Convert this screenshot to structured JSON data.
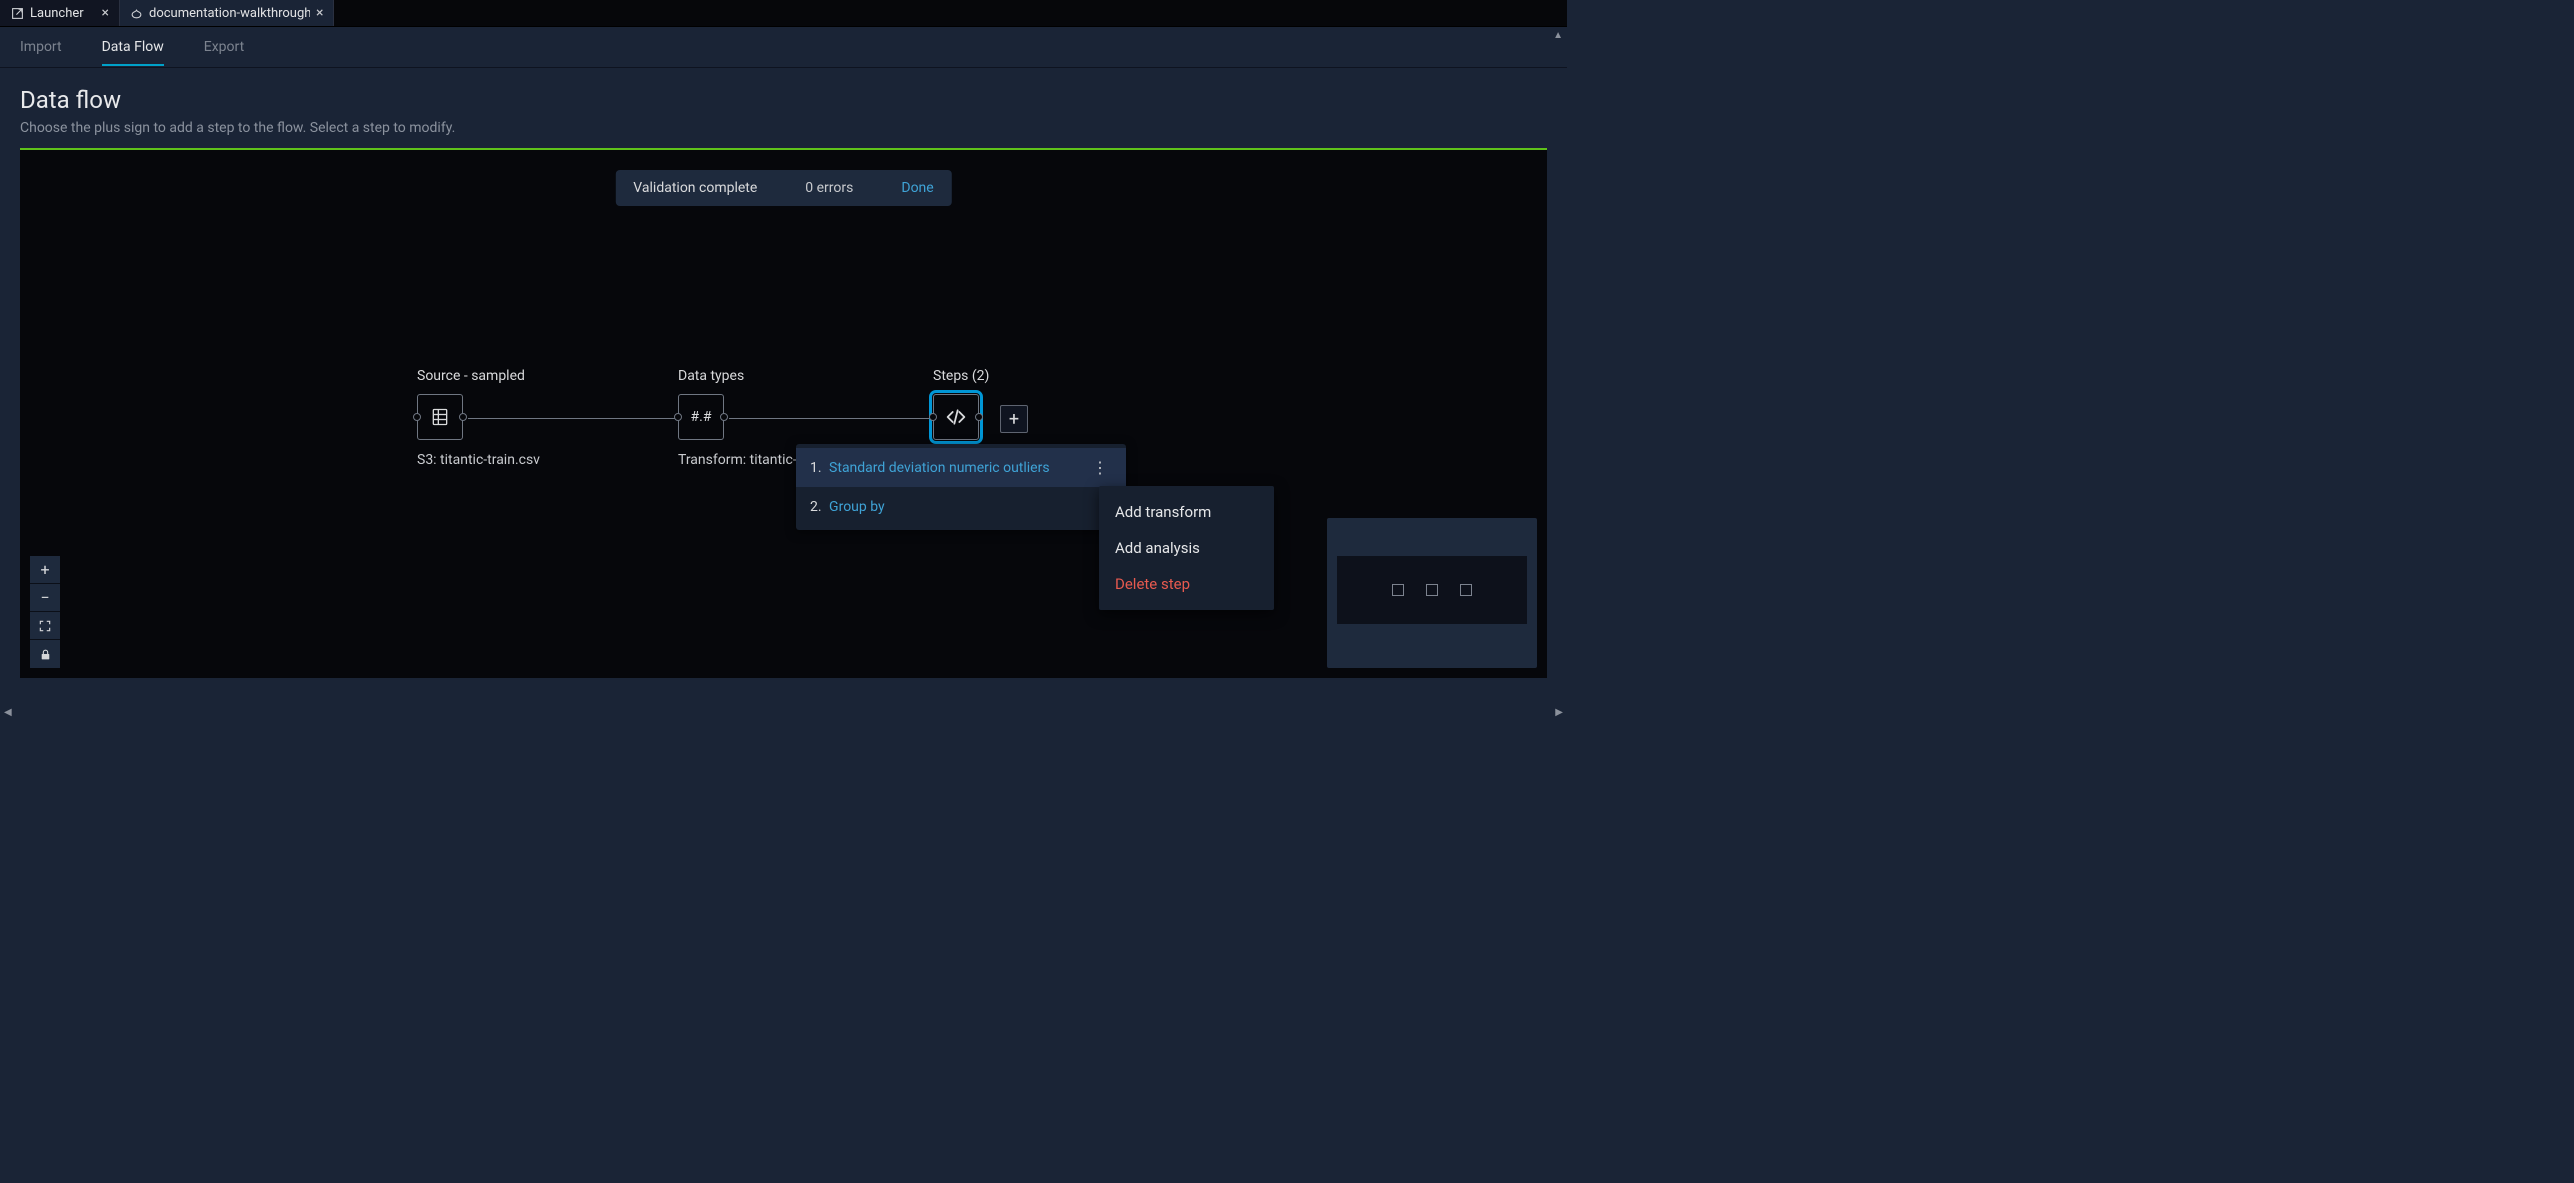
{
  "tabs": {
    "launcher": "Launcher",
    "doc": "documentation-walkthrough-"
  },
  "subnav": {
    "import": "Import",
    "data_flow": "Data Flow",
    "export": "Export"
  },
  "header": {
    "title": "Data flow",
    "hint": "Choose the plus sign to add a step to the flow. Select a step to modify."
  },
  "validation": {
    "status": "Validation complete",
    "errors": "0 errors",
    "done": "Done"
  },
  "nodes": {
    "source": {
      "title": "Source - sampled",
      "sub": "S3: titantic-train.csv"
    },
    "types": {
      "title": "Data types",
      "sub": "Transform: titantic-t",
      "glyph": "#.#"
    },
    "steps": {
      "title": "Steps (2)"
    }
  },
  "steps_popover": {
    "items": [
      {
        "idx": "1.",
        "label": "Standard deviation numeric outliers"
      },
      {
        "idx": "2.",
        "label": "Group by"
      }
    ]
  },
  "context_menu": {
    "add_transform": "Add transform",
    "add_analysis": "Add analysis",
    "delete_step": "Delete step"
  }
}
